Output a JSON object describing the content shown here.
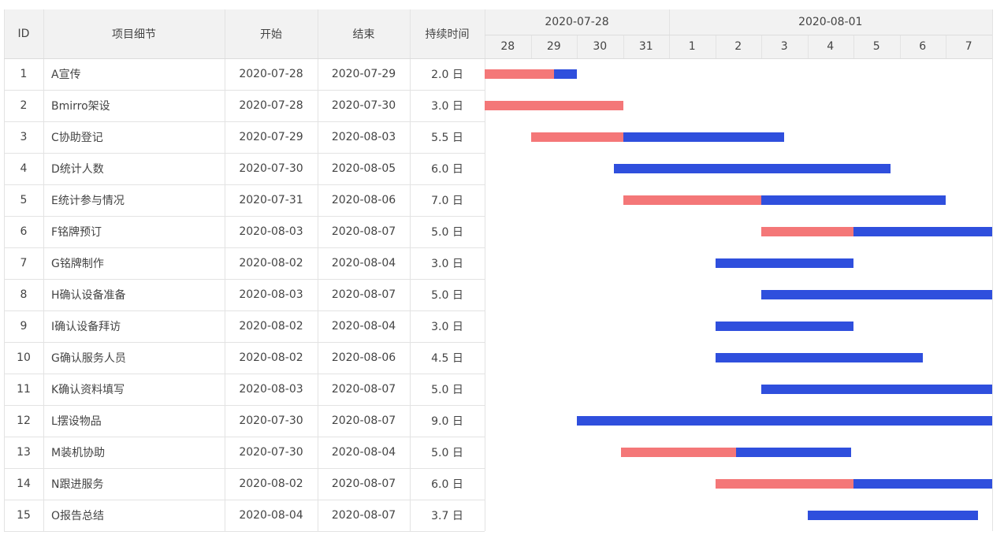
{
  "chart_data": {
    "type": "gantt",
    "columns": {
      "id": "ID",
      "detail": "项目细节",
      "start": "开始",
      "end": "结束",
      "duration": "持续时间"
    },
    "timeline": {
      "groups": [
        "2020-07-28",
        "2020-08-01"
      ],
      "days": [
        "28",
        "29",
        "30",
        "31",
        "1",
        "2",
        "3",
        "4",
        "5",
        "6",
        "7"
      ],
      "day_dates": [
        "2020-07-28",
        "2020-07-29",
        "2020-07-30",
        "2020-07-31",
        "2020-08-01",
        "2020-08-02",
        "2020-08-03",
        "2020-08-04",
        "2020-08-05",
        "2020-08-06",
        "2020-08-07"
      ]
    },
    "colors": {
      "planned": "#2f4fdd",
      "progress": "#f47778"
    },
    "tasks": [
      {
        "id": "1",
        "name": "A宣传",
        "start": "2020-07-28",
        "end": "2020-07-29",
        "duration": "2.0 日",
        "bar_start": 0.0,
        "bar_end": 2.0,
        "progress_end": 1.5
      },
      {
        "id": "2",
        "name": "Bmirro架设",
        "start": "2020-07-28",
        "end": "2020-07-30",
        "duration": "3.0 日",
        "bar_start": 0.0,
        "bar_end": 3.0,
        "progress_end": 3.0
      },
      {
        "id": "3",
        "name": "C协助登记",
        "start": "2020-07-29",
        "end": "2020-08-03",
        "duration": "5.5 日",
        "bar_start": 1.0,
        "bar_end": 6.5,
        "progress_end": 3.0
      },
      {
        "id": "4",
        "name": "D统计人数",
        "start": "2020-07-30",
        "end": "2020-08-05",
        "duration": "6.0 日",
        "bar_start": 2.8,
        "bar_end": 8.8,
        "progress_end": null
      },
      {
        "id": "5",
        "name": "E统计参与情况",
        "start": "2020-07-31",
        "end": "2020-08-06",
        "duration": "7.0 日",
        "bar_start": 3.0,
        "bar_end": 10.0,
        "progress_end": 6.0
      },
      {
        "id": "6",
        "name": "F铭牌预订",
        "start": "2020-08-03",
        "end": "2020-08-07",
        "duration": "5.0 日",
        "bar_start": 6.0,
        "bar_end": 11.0,
        "progress_end": 8.0
      },
      {
        "id": "7",
        "name": "G铭牌制作",
        "start": "2020-08-02",
        "end": "2020-08-04",
        "duration": "3.0 日",
        "bar_start": 5.0,
        "bar_end": 8.0,
        "progress_end": null
      },
      {
        "id": "8",
        "name": "H确认设备准备",
        "start": "2020-08-03",
        "end": "2020-08-07",
        "duration": "5.0 日",
        "bar_start": 6.0,
        "bar_end": 11.0,
        "progress_end": null
      },
      {
        "id": "9",
        "name": "I确认设备拜访",
        "start": "2020-08-02",
        "end": "2020-08-04",
        "duration": "3.0 日",
        "bar_start": 5.0,
        "bar_end": 8.0,
        "progress_end": null
      },
      {
        "id": "10",
        "name": "G确认服务人员",
        "start": "2020-08-02",
        "end": "2020-08-06",
        "duration": "4.5 日",
        "bar_start": 5.0,
        "bar_end": 9.5,
        "progress_end": null
      },
      {
        "id": "11",
        "name": "K确认资料填写",
        "start": "2020-08-03",
        "end": "2020-08-07",
        "duration": "5.0 日",
        "bar_start": 6.0,
        "bar_end": 11.0,
        "progress_end": null
      },
      {
        "id": "12",
        "name": "L摆设物品",
        "start": "2020-07-30",
        "end": "2020-08-07",
        "duration": "9.0 日",
        "bar_start": 2.0,
        "bar_end": 11.0,
        "progress_end": null
      },
      {
        "id": "13",
        "name": "M装机协助",
        "start": "2020-07-30",
        "end": "2020-08-04",
        "duration": "5.0 日",
        "bar_start": 2.95,
        "bar_end": 7.95,
        "progress_end": 5.45
      },
      {
        "id": "14",
        "name": "N跟进服务",
        "start": "2020-08-02",
        "end": "2020-08-07",
        "duration": "6.0 日",
        "bar_start": 5.0,
        "bar_end": 11.0,
        "progress_end": 8.0
      },
      {
        "id": "15",
        "name": "O报告总结",
        "start": "2020-08-04",
        "end": "2020-08-07",
        "duration": "3.7 日",
        "bar_start": 7.0,
        "bar_end": 10.7,
        "progress_end": null
      }
    ]
  }
}
